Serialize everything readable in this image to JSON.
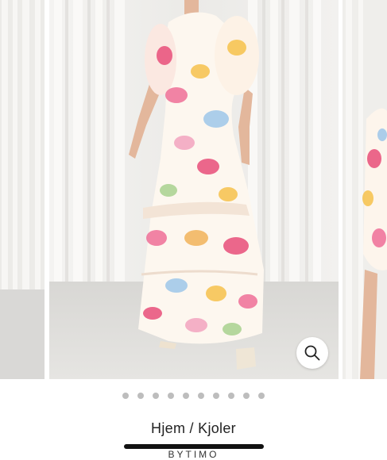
{
  "gallery": {
    "slide_count": 10,
    "active_slide": 1,
    "zoom_icon": "search-icon"
  },
  "breadcrumb": {
    "home": "Hjem",
    "separator": " / ",
    "category": "Kjoler"
  },
  "brand": {
    "name": "BYTIMO"
  },
  "colors": {
    "dot": "#bdbdbd",
    "text": "#222222"
  }
}
